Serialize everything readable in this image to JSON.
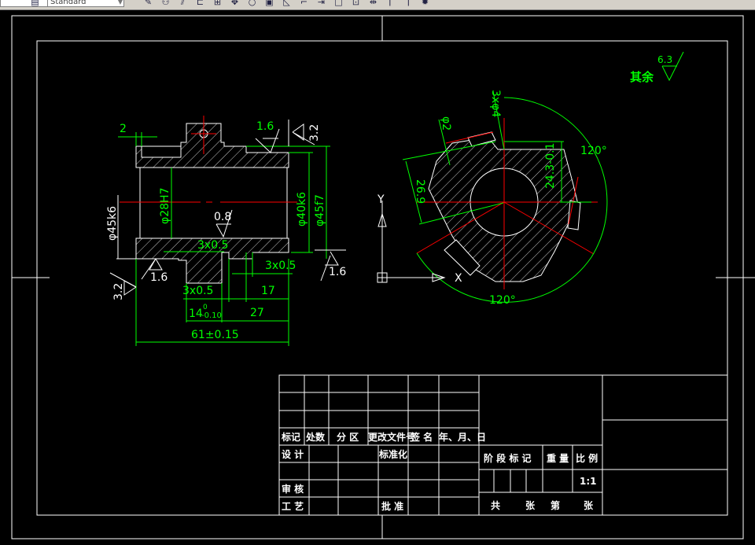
{
  "toolbar": {
    "style_dropdown": "Standard",
    "icons": [
      "hatch-icon",
      "draw-order-icon",
      "mirror-icon",
      "offset-icon",
      "array-icon",
      "move-icon",
      "rotate-icon",
      "scale-icon",
      "stretch-icon",
      "trim-icon",
      "extend-icon",
      "break-icon",
      "break-at-point-icon",
      "join-icon",
      "chamfer-icon",
      "fillet-icon",
      "explode-icon"
    ]
  },
  "colors": {
    "background": "#000000",
    "geometry": "#ffffff",
    "dimension": "#00ff00",
    "centerline": "#ff0000"
  },
  "left_view": {
    "dims": {
      "d_2": "2",
      "rough_top": "1.6",
      "rough_top_right": "3.2",
      "bore": "φ28H7",
      "d40": "φ40k6",
      "d45f7": "φ45f7",
      "d45k6": "φ45k6",
      "rough_bore": "0.8",
      "groove_inner": "3x0.5",
      "groove_right": "3x0.5",
      "rough_right": "1.6",
      "rough_bottom": "1.6",
      "rough_left": "3.2",
      "groove_bottom": "3x0.5",
      "len_17": "17",
      "len_14": "14",
      "tol_14_upper": "0",
      "tol_14_lower": "-0.10",
      "len_27": "27",
      "len_61": "61±0.15"
    }
  },
  "right_view": {
    "dims": {
      "holes": "3xφ4",
      "d_phi2": "φ2",
      "d_26_9": "26.9",
      "d_24_3": "24.3-0.1",
      "angle_top": "120°",
      "angle_bottom": "120°"
    },
    "ucs": {
      "y": "Y",
      "x": "X"
    }
  },
  "general_roughness": {
    "label": "其余",
    "value": "6.3"
  },
  "title_block": {
    "header": [
      "标记",
      "处数",
      "分 区",
      "更改文件号",
      "签 名",
      "年、月、日"
    ],
    "design": "设 计",
    "standardize": "标准化",
    "review": "审 核",
    "process": "工 艺",
    "approve": "批 准",
    "stage_mark": "阶 段 标 记",
    "weight": "重 量",
    "scale": "比 例",
    "scale_value": "1:1",
    "total": "共",
    "sheets": "张",
    "no": "第",
    "sheet": "张"
  }
}
